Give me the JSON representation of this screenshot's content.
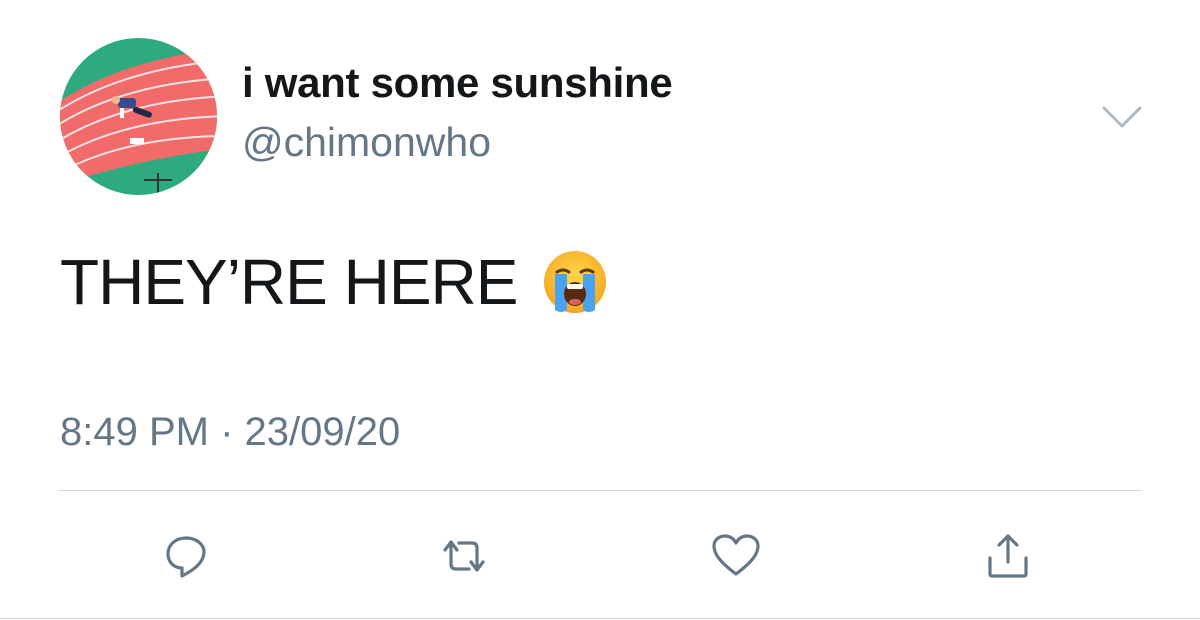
{
  "tweet": {
    "author": {
      "display_name": "i want some sunshine",
      "handle": "@chimonwho",
      "avatar_icon": "running-track-photo"
    },
    "text": "THEY’RE HERE",
    "emoji": "loudly-crying-face",
    "timestamp": "8:49 PM · 23/09/20",
    "menu_icon": "chevron-down-icon",
    "actions": [
      {
        "name": "reply",
        "icon": "speech-bubble-icon"
      },
      {
        "name": "retweet",
        "icon": "retweet-icon"
      },
      {
        "name": "like",
        "icon": "heart-icon"
      },
      {
        "name": "share",
        "icon": "share-icon"
      }
    ]
  },
  "colors": {
    "text_primary": "#14171a",
    "text_secondary": "#657786",
    "icon": "#657786",
    "divider": "#d3d9de",
    "background": "#ffffff"
  }
}
